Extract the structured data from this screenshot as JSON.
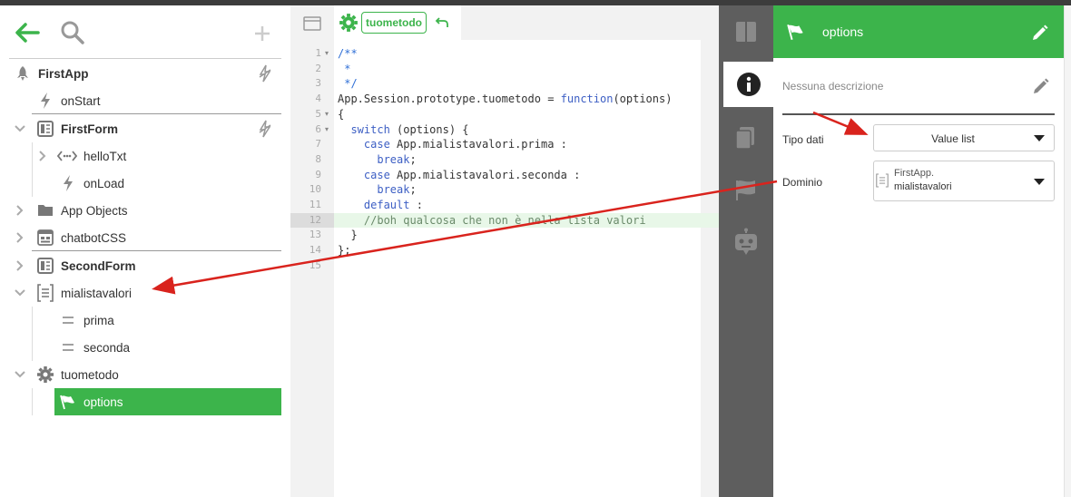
{
  "tree": {
    "items": [
      {
        "label": "FirstApp"
      },
      {
        "label": "onStart"
      },
      {
        "label": "FirstForm"
      },
      {
        "label": "helloTxt"
      },
      {
        "label": "onLoad"
      },
      {
        "label": "App Objects"
      },
      {
        "label": "chatbotCSS"
      },
      {
        "label": "SecondForm"
      },
      {
        "label": "mialistavalori"
      },
      {
        "label": "prima"
      },
      {
        "label": "seconda"
      },
      {
        "label": "tuometodo"
      },
      {
        "label": "options"
      }
    ]
  },
  "editor": {
    "method_name": "tuometodo",
    "line_numbers": [
      "1",
      "2",
      "3",
      "4",
      "5",
      "6",
      "7",
      "8",
      "9",
      "10",
      "11",
      "12",
      "13",
      "14",
      "15"
    ],
    "lines": [
      "/**",
      " *",
      " */",
      "App.Session.prototype.tuometodo = function(options)",
      "{",
      "  switch (options) {",
      "    case App.mialistavalori.prima :",
      "      break;",
      "    case App.mialistavalori.seconda :",
      "      break;",
      "    default :",
      "    //boh qualcosa che non è nella lista valori",
      "  }",
      "};",
      ""
    ]
  },
  "props": {
    "title": "options",
    "description_placeholder": "Nessuna descrizione",
    "tipo_label": "Tipo dati",
    "tipo_value": "Value list",
    "dominio_label": "Dominio",
    "dominio_value_line1": "FirstApp.",
    "dominio_value_line2": "mialistavalori"
  },
  "colors": {
    "accent": "#3cb44b",
    "sidebar": "#5e5e5e",
    "arrow": "#d9231d"
  }
}
